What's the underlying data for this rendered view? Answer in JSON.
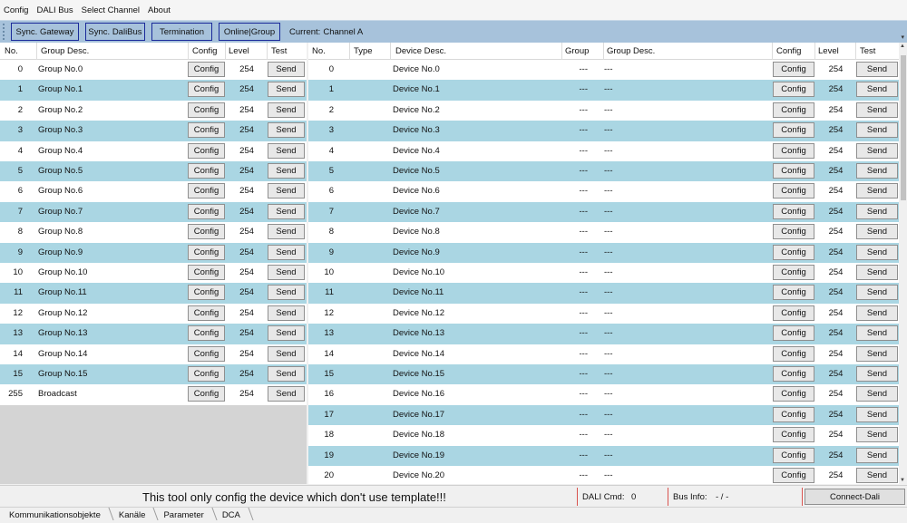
{
  "menu": [
    "Config",
    "DALI Bus",
    "Select Channel",
    "About"
  ],
  "toolbar": {
    "buttons": [
      "Sync. Gateway",
      "Sync. DaliBus",
      "Termination",
      "Online|Group"
    ],
    "current_label": "Current:",
    "current_value": "Channel A"
  },
  "groups": {
    "headers": {
      "no": "No.",
      "desc": "Group Desc.",
      "config": "Config",
      "level": "Level",
      "test": "Test"
    },
    "config_label": "Config",
    "send_label": "Send",
    "rows": [
      {
        "no": "0",
        "desc": "Group No.0",
        "level": "254"
      },
      {
        "no": "1",
        "desc": "Group No.1",
        "level": "254"
      },
      {
        "no": "2",
        "desc": "Group No.2",
        "level": "254"
      },
      {
        "no": "3",
        "desc": "Group No.3",
        "level": "254"
      },
      {
        "no": "4",
        "desc": "Group No.4",
        "level": "254"
      },
      {
        "no": "5",
        "desc": "Group No.5",
        "level": "254"
      },
      {
        "no": "6",
        "desc": "Group No.6",
        "level": "254"
      },
      {
        "no": "7",
        "desc": "Group No.7",
        "level": "254"
      },
      {
        "no": "8",
        "desc": "Group No.8",
        "level": "254"
      },
      {
        "no": "9",
        "desc": "Group No.9",
        "level": "254"
      },
      {
        "no": "10",
        "desc": "Group No.10",
        "level": "254"
      },
      {
        "no": "11",
        "desc": "Group No.11",
        "level": "254"
      },
      {
        "no": "12",
        "desc": "Group No.12",
        "level": "254"
      },
      {
        "no": "13",
        "desc": "Group No.13",
        "level": "254"
      },
      {
        "no": "14",
        "desc": "Group No.14",
        "level": "254"
      },
      {
        "no": "15",
        "desc": "Group No.15",
        "level": "254"
      },
      {
        "no": "255",
        "desc": "Broadcast",
        "level": "254"
      }
    ]
  },
  "devices": {
    "headers": {
      "no": "No.",
      "type": "Type",
      "desc": "Device Desc.",
      "group": "Group",
      "group_desc": "Group Desc.",
      "config": "Config",
      "level": "Level",
      "test": "Test"
    },
    "config_label": "Config",
    "send_label": "Send",
    "rows": [
      {
        "no": "0",
        "type": "",
        "desc": "Device No.0",
        "group": "---",
        "group_desc": "---",
        "level": "254"
      },
      {
        "no": "1",
        "type": "",
        "desc": "Device No.1",
        "group": "---",
        "group_desc": "---",
        "level": "254"
      },
      {
        "no": "2",
        "type": "",
        "desc": "Device No.2",
        "group": "---",
        "group_desc": "---",
        "level": "254"
      },
      {
        "no": "3",
        "type": "",
        "desc": "Device No.3",
        "group": "---",
        "group_desc": "---",
        "level": "254"
      },
      {
        "no": "4",
        "type": "",
        "desc": "Device No.4",
        "group": "---",
        "group_desc": "---",
        "level": "254"
      },
      {
        "no": "5",
        "type": "",
        "desc": "Device No.5",
        "group": "---",
        "group_desc": "---",
        "level": "254"
      },
      {
        "no": "6",
        "type": "",
        "desc": "Device No.6",
        "group": "---",
        "group_desc": "---",
        "level": "254"
      },
      {
        "no": "7",
        "type": "",
        "desc": "Device No.7",
        "group": "---",
        "group_desc": "---",
        "level": "254"
      },
      {
        "no": "8",
        "type": "",
        "desc": "Device No.8",
        "group": "---",
        "group_desc": "---",
        "level": "254"
      },
      {
        "no": "9",
        "type": "",
        "desc": "Device No.9",
        "group": "---",
        "group_desc": "---",
        "level": "254"
      },
      {
        "no": "10",
        "type": "",
        "desc": "Device No.10",
        "group": "---",
        "group_desc": "---",
        "level": "254"
      },
      {
        "no": "11",
        "type": "",
        "desc": "Device No.11",
        "group": "---",
        "group_desc": "---",
        "level": "254"
      },
      {
        "no": "12",
        "type": "",
        "desc": "Device No.12",
        "group": "---",
        "group_desc": "---",
        "level": "254"
      },
      {
        "no": "13",
        "type": "",
        "desc": "Device No.13",
        "group": "---",
        "group_desc": "---",
        "level": "254"
      },
      {
        "no": "14",
        "type": "",
        "desc": "Device No.14",
        "group": "---",
        "group_desc": "---",
        "level": "254"
      },
      {
        "no": "15",
        "type": "",
        "desc": "Device No.15",
        "group": "---",
        "group_desc": "---",
        "level": "254"
      },
      {
        "no": "16",
        "type": "",
        "desc": "Device No.16",
        "group": "---",
        "group_desc": "---",
        "level": "254"
      },
      {
        "no": "17",
        "type": "",
        "desc": "Device No.17",
        "group": "---",
        "group_desc": "---",
        "level": "254"
      },
      {
        "no": "18",
        "type": "",
        "desc": "Device No.18",
        "group": "---",
        "group_desc": "---",
        "level": "254"
      },
      {
        "no": "19",
        "type": "",
        "desc": "Device No.19",
        "group": "---",
        "group_desc": "---",
        "level": "254"
      },
      {
        "no": "20",
        "type": "",
        "desc": "Device No.20",
        "group": "---",
        "group_desc": "---",
        "level": "254"
      }
    ]
  },
  "status": {
    "message": "This tool only config the device which don't use template!!!",
    "dali_cmd_label": "DALI Cmd:",
    "dali_cmd_value": "0",
    "bus_info_label": "Bus Info:",
    "bus_info_value": "- / -",
    "connect_label": "Connect-Dali"
  },
  "tabs": [
    "Kommunikationsobjekte",
    "Kanäle",
    "Parameter",
    "DCA"
  ],
  "colors": {
    "alt_row": "#aad6e3",
    "toolbar": "#a7c2db",
    "status_separator": "#d9534f"
  }
}
